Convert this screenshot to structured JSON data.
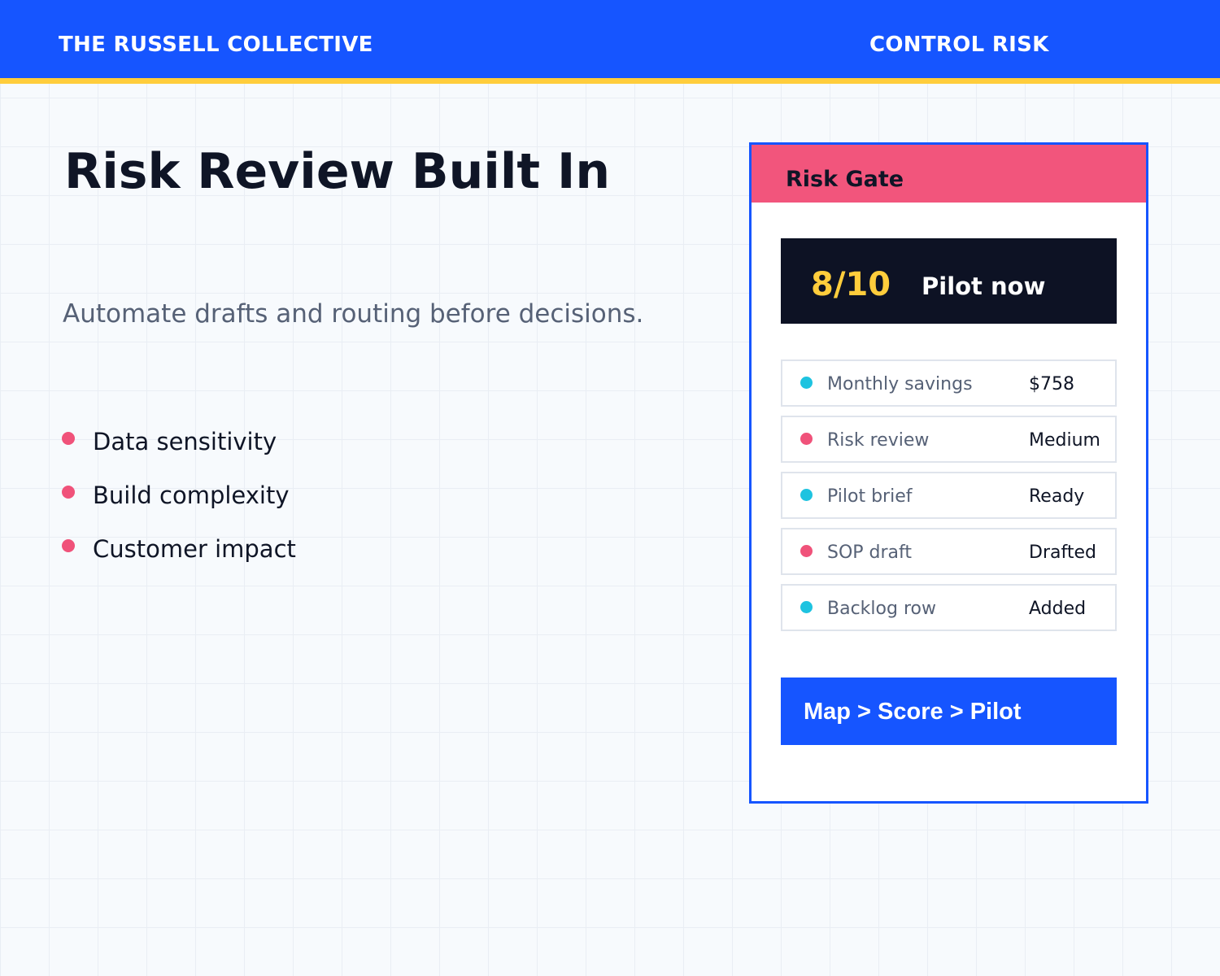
{
  "header": {
    "brand": "THE RUSSELL COLLECTIVE",
    "section": "CONTROL RISK",
    "background_color": "#1655ff",
    "accent_stripe_color": "#ffcd3c"
  },
  "main": {
    "title": "Risk Review Built In",
    "subtitle": "Automate drafts and routing before decisions.",
    "bullets": [
      "Data sensitivity",
      "Build complexity",
      "Customer impact"
    ],
    "bullet_color": "#f0527a"
  },
  "card": {
    "title": "Risk Gate",
    "header_color": "#f2557c",
    "score": "8/10",
    "verdict": "Pilot now",
    "metrics": [
      {
        "label": "Monthly savings",
        "value": "$758",
        "dot_color": "#1ec3e0"
      },
      {
        "label": "Risk review",
        "value": "Medium",
        "dot_color": "#f0527a"
      },
      {
        "label": "Pilot brief",
        "value": "Ready",
        "dot_color": "#1ec3e0"
      },
      {
        "label": "SOP draft",
        "value": "Drafted",
        "dot_color": "#f0527a"
      },
      {
        "label": "Backlog row",
        "value": "Added",
        "dot_color": "#1ec3e0"
      }
    ],
    "action_label": "Map > Score > Pilot"
  }
}
